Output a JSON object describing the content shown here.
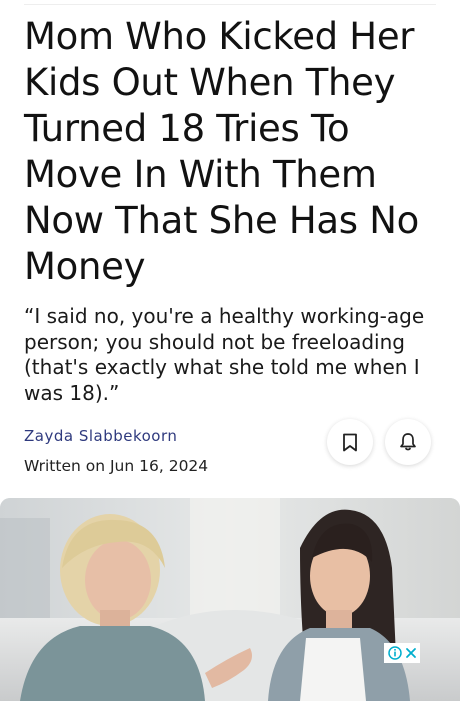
{
  "article": {
    "headline": "Mom Who Kicked Her Kids Out When They Turned 18 Tries To Move In With Them Now That She Has No Money",
    "dek": "“I said no, you're a healthy working-age person; you should not be freeloading (that's exactly what she told me when I was 18).”",
    "author": "Zayda Slabbekoorn",
    "written_on": "Written on Jun 16, 2024"
  },
  "actions": {
    "bookmark_icon": "bookmark-icon",
    "bell_icon": "bell-icon"
  },
  "hero_image": {
    "description_icon": "photo"
  },
  "ad": {
    "info_icon": "info-icon",
    "close_icon": "close-icon",
    "accent": "#00aecd"
  }
}
